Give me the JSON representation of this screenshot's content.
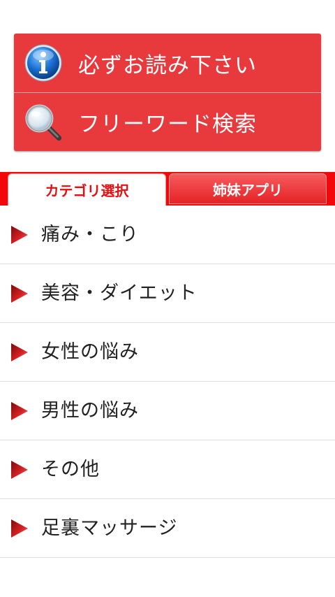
{
  "top_buttons": {
    "read_first_label": "必ずお読み下さい",
    "read_first_icon": "info-icon",
    "search_label": "フリーワード検索",
    "search_icon": "magnifier-icon"
  },
  "tabs": [
    {
      "label": "カテゴリ選択",
      "active": true
    },
    {
      "label": "姉妹アプリ",
      "active": false
    }
  ],
  "categories": [
    {
      "label": "痛み・こり"
    },
    {
      "label": "美容・ダイエット"
    },
    {
      "label": "女性の悩み"
    },
    {
      "label": "男性の悩み"
    },
    {
      "label": "その他"
    },
    {
      "label": "足裏マッサージ"
    }
  ],
  "colors": {
    "accent_red": "#e8393c",
    "tab_bar_red": "#f2070b",
    "active_tab_text": "#e30f12",
    "list_text": "#222222"
  }
}
